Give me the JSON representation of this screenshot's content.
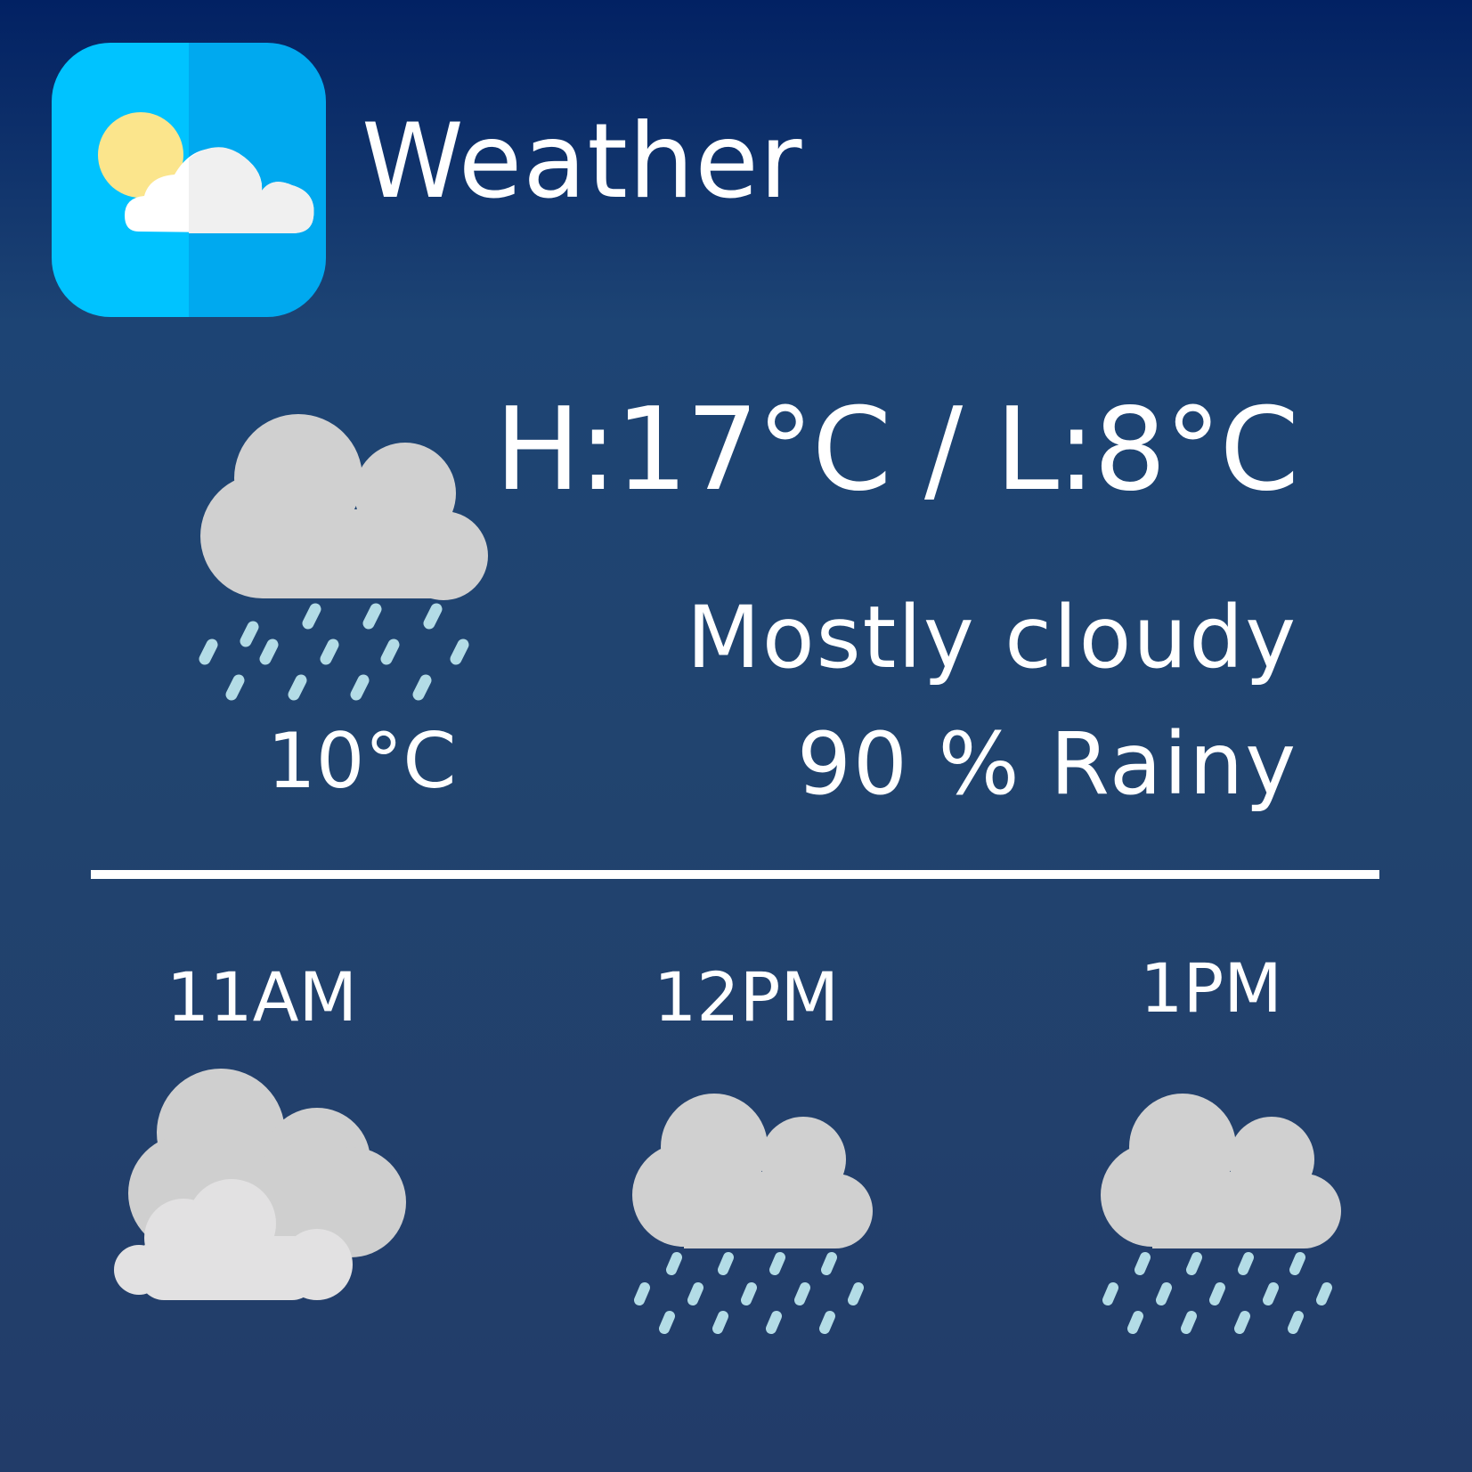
{
  "app": {
    "title": "Weather",
    "icon": "partly-cloudy-app-icon"
  },
  "current": {
    "high_low": "H:17°C / L:8°C",
    "condition": "Mostly cloudy",
    "rain_chance": "90 % Rainy",
    "temperature": "10°C",
    "icon": "rain-cloud-icon"
  },
  "hourly": [
    {
      "time": "11AM",
      "icon": "cloudy-icon"
    },
    {
      "time": "12PM",
      "icon": "rain-cloud-icon"
    },
    {
      "time": "1PM",
      "icon": "rain-cloud-icon"
    }
  ],
  "colors": {
    "background_top": "#022163",
    "background_bottom": "#223c69",
    "app_icon_light": "#00c3ff",
    "app_icon_dark": "#00a9ef",
    "sun": "#fbe58c",
    "cloud": "#d0d0d0",
    "cloud_light": "#e2e1e2",
    "rain": "#b3dce6"
  }
}
